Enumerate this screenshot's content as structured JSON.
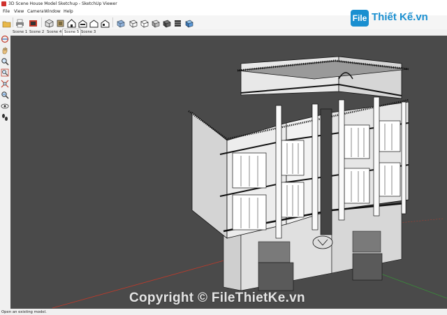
{
  "window": {
    "title": "3D Scene House Model Sketchup - SketchUp Viewer"
  },
  "menu": [
    "File",
    "View",
    "Camera",
    "Window",
    "Help"
  ],
  "scenes": [
    "Scene 1",
    "Scene 2",
    "Scene 4",
    "Scene 5",
    "Scene 3"
  ],
  "active_scene": "Scene 5",
  "status": "Open an existing model.",
  "logo": {
    "f": "File",
    "text": "Thiết Kế.vn"
  },
  "watermark": "Copyright © FileThietKe.vn",
  "toolbar_icons": [
    "open-file-icon",
    "print-icon",
    "model-info-icon",
    "iso-view-icon",
    "top-view-icon",
    "front-view-icon",
    "right-view-icon",
    "back-view-icon",
    "left-view-icon",
    "xray-icon",
    "wireframe-icon",
    "hidden-line-icon",
    "shaded-icon",
    "shaded-textures-icon",
    "monochrome-icon"
  ],
  "side_icons": [
    "orbit-icon",
    "pan-icon",
    "zoom-icon",
    "zoom-window-icon",
    "zoom-extents-icon",
    "previous-icon",
    "look-around-icon",
    "walk-icon"
  ],
  "colors": {
    "viewport_bg": "#4a4a4a",
    "accent": "#1a8fd0",
    "red_axis": "#c23a2a",
    "green_axis": "#3a8c3a"
  }
}
